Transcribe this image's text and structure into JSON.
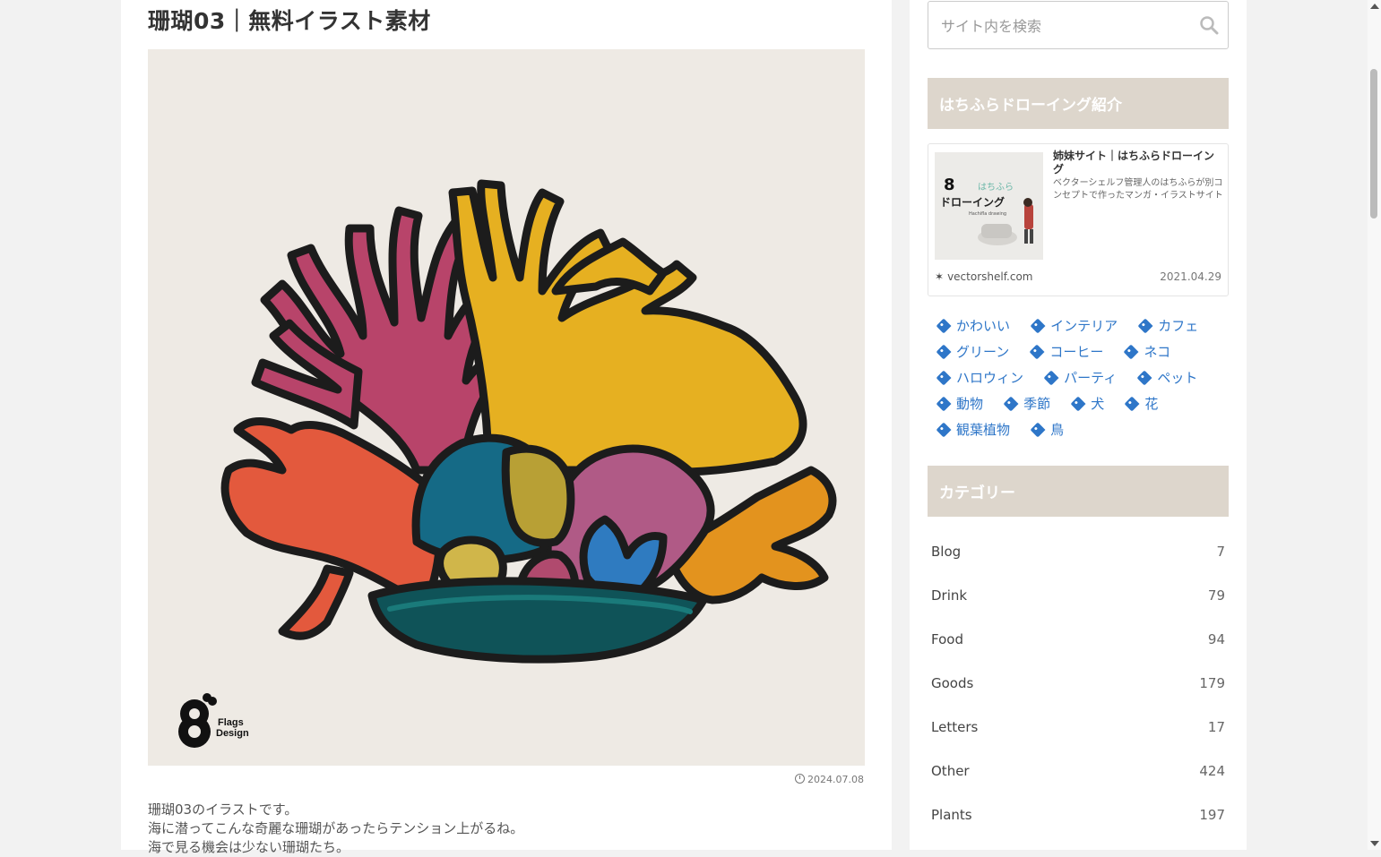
{
  "post": {
    "title": "珊瑚03｜無料イラスト素材",
    "logo_text_1": "Flags",
    "logo_text_2": "Design",
    "date": "2024.07.08",
    "body": [
      "珊瑚03のイラストです。",
      "海に潜ってこんな奇麗な珊瑚があったらテンション上がるね。",
      "海で見る機会は少ない珊瑚たち。"
    ]
  },
  "sidebar": {
    "search_placeholder": "サイト内を検索",
    "intro_heading": "はちふらドローイング紹介",
    "card": {
      "title": "姉妹サイト｜はちふらドローイング",
      "description": "ベクターシェルフ管理人のはちふらが別コンセプトで作ったマンガ・イラストサイト",
      "thumb_title_1": "はちふら",
      "thumb_title_2": "ドローイング",
      "thumb_sub": "Hachifla drawing",
      "site": "vectorshelf.com",
      "date": "2021.04.29"
    },
    "tags": [
      "かわいい",
      "インテリア",
      "カフェ",
      "グリーン",
      "コーヒー",
      "ネコ",
      "ハロウィン",
      "パーティ",
      "ペット",
      "動物",
      "季節",
      "犬",
      "花",
      "観葉植物",
      "鳥"
    ],
    "category_heading": "カテゴリー",
    "categories": [
      {
        "name": "Blog",
        "count": "7"
      },
      {
        "name": "Drink",
        "count": "79"
      },
      {
        "name": "Food",
        "count": "94"
      },
      {
        "name": "Goods",
        "count": "179"
      },
      {
        "name": "Letters",
        "count": "17"
      },
      {
        "name": "Other",
        "count": "424"
      },
      {
        "name": "Plants",
        "count": "197"
      }
    ]
  },
  "colors": {
    "accent_tag": "#2e76c8",
    "widget_head_bg": "#ddd6cc",
    "illust_bg": "#eeeae4"
  }
}
